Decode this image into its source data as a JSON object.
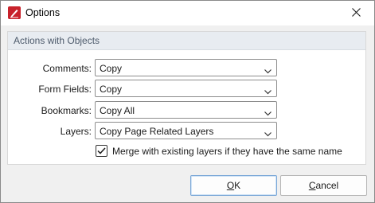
{
  "window": {
    "title": "Options",
    "app_icon": "pdf-editor-app-icon",
    "close_icon": "close-icon"
  },
  "group": {
    "title": "Actions with Objects",
    "rows": [
      {
        "label": "Comments:",
        "value": "Copy"
      },
      {
        "label": "Form Fields:",
        "value": "Copy"
      },
      {
        "label": "Bookmarks:",
        "value": "Copy All"
      },
      {
        "label": "Layers:",
        "value": "Copy Page Related Layers"
      }
    ],
    "merge_checkbox": {
      "label": "Merge with existing layers if they have the same name",
      "checked": true
    }
  },
  "buttons": {
    "ok": {
      "mnemonic": "O",
      "rest": "K"
    },
    "cancel": {
      "mnemonic": "C",
      "rest": "ancel"
    }
  },
  "colors": {
    "accent": "#c8222b",
    "group_header": "#e8ecf1",
    "group_title": "#4e5b6c"
  }
}
